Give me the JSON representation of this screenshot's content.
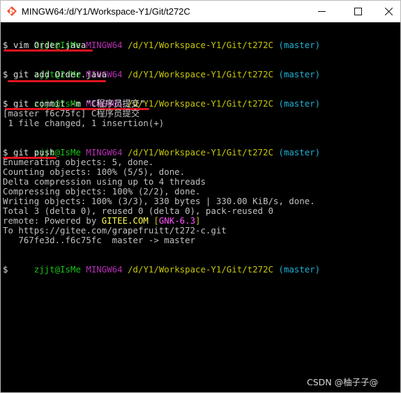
{
  "window": {
    "title": "MINGW64:/d/Y1/Workspace-Y1/Git/t272C",
    "icon": "git-bash-icon",
    "controls": {
      "minimize": "—",
      "maximize": "☐",
      "close": "✕"
    }
  },
  "prompt": {
    "user": "zjjt@IsMe",
    "system": "MINGW64",
    "path": "/d/Y1/Workspace-Y1/Git/t272C",
    "branch": "(master)",
    "symbol": "$"
  },
  "commands": {
    "vim": "vim Order.java",
    "add": "git add Order.java",
    "commit": "git commit -m \"C程序员提交\"",
    "push": "git push"
  },
  "commit_output": [
    "[master f6c75fc] C程序员提交",
    " 1 file changed, 1 insertion(+)"
  ],
  "push_output": [
    "Enumerating objects: 5, done.",
    "Counting objects: 100% (5/5), done.",
    "Delta compression using up to 4 threads",
    "Compressing objects: 100% (2/2), done.",
    "Writing objects: 100% (3/3), 330 bytes | 330.00 KiB/s, done.",
    "Total 3 (delta 0), reused 0 (delta 0), pack-reused 0"
  ],
  "remote_line": {
    "prefix": "remote: Powered by ",
    "gitee": "GITEE.COM",
    "space": " ",
    "open": "[",
    "gnk": "GNK-6.3",
    "close": "]"
  },
  "push_tail": [
    "To https://gitee.com/grapefruitt/t272-c.git",
    "   767fe3d..f6c75fc  master -> master"
  ],
  "watermark": "CSDN @柚子子@",
  "colors": {
    "user": "#17c617",
    "system": "#b32fb3",
    "path": "#c7c70c",
    "branch": "#1fb2d6",
    "annotation": "#e0141f"
  }
}
